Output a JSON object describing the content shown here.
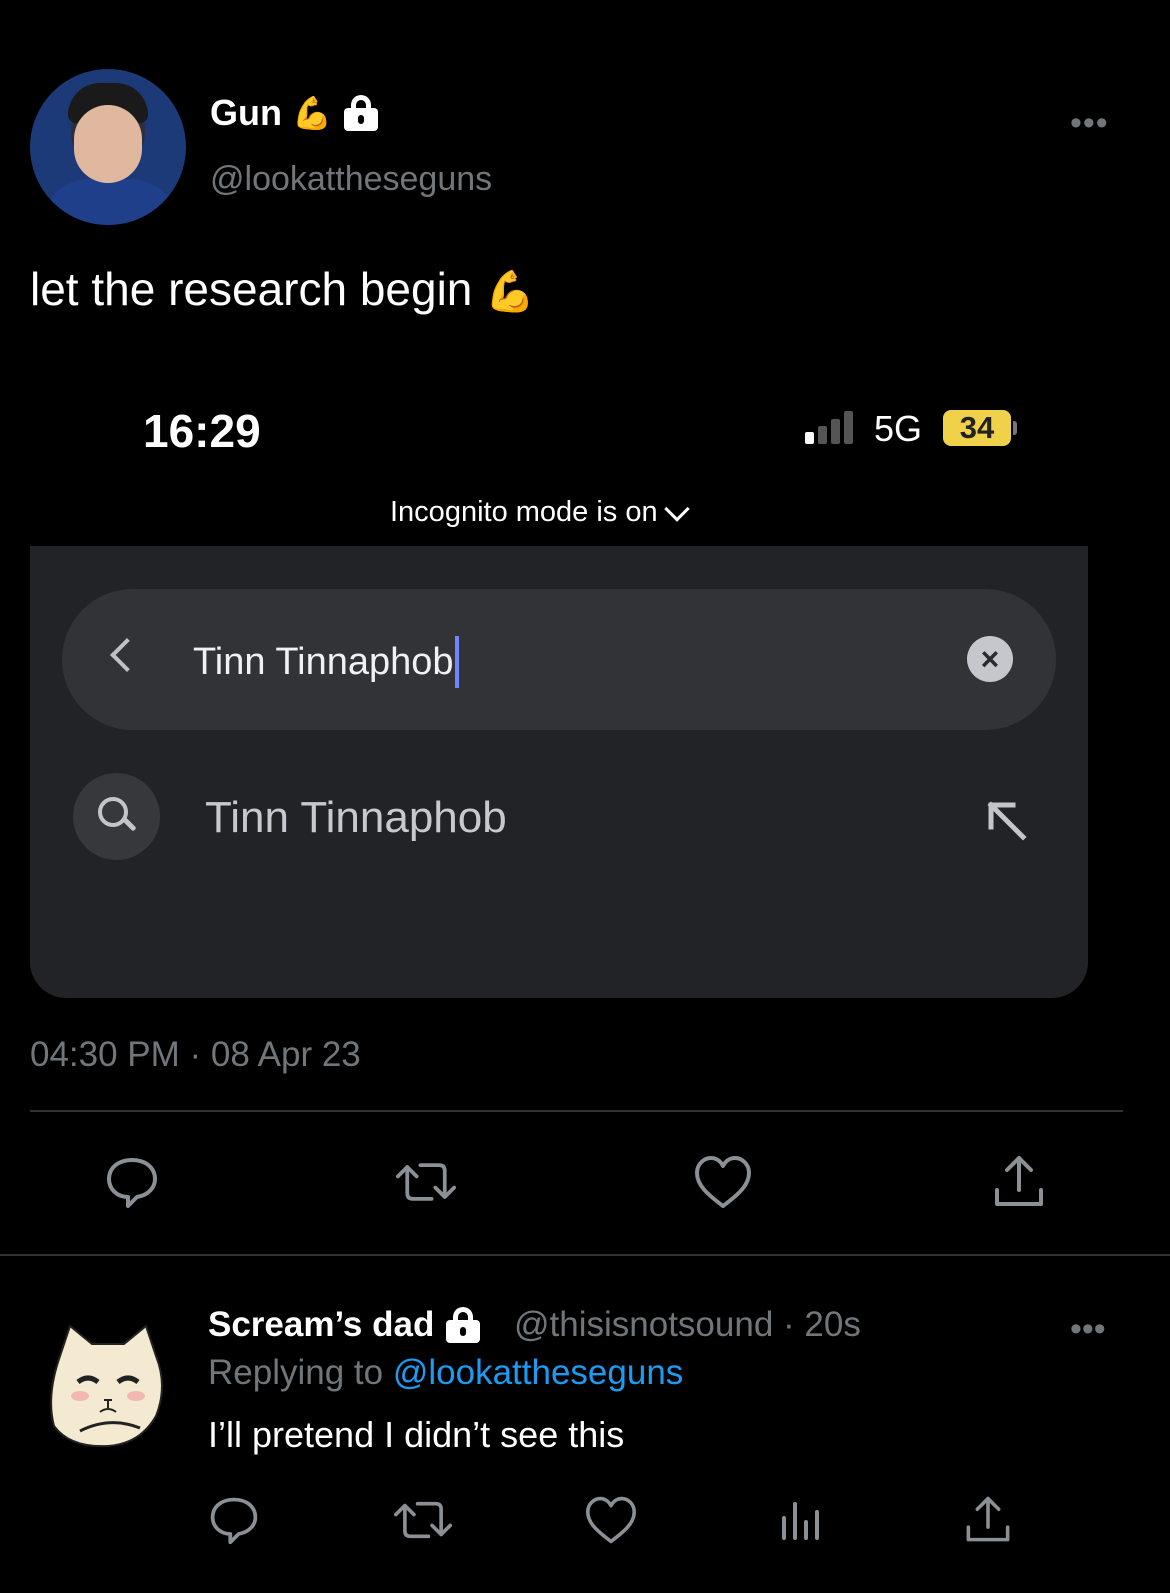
{
  "tweet": {
    "display_name": "Gun",
    "name_emoji": "💪",
    "handle": "@lookattheseguns",
    "more_label": "•••",
    "text": "let the research begin",
    "text_emoji": "💪",
    "timestamp": "04:30 PM · 08 Apr 23"
  },
  "embedded_screenshot": {
    "status_time": "16:29",
    "network": "5G",
    "battery": "34",
    "incognito_label": "Incognito mode is on",
    "search_value": "Tinn Tinnaphob",
    "clear_label": "×",
    "suggestion": "Tinn Tinnaphob"
  },
  "actions": [
    {
      "icon": "reply-icon"
    },
    {
      "icon": "retweet-icon"
    },
    {
      "icon": "like-icon"
    },
    {
      "icon": "share-icon"
    }
  ],
  "reply": {
    "display_name": "Scream’s dad",
    "handle_time": "@thisisnotsound · 20s",
    "more_label": "•••",
    "replying_prefix": "Replying to",
    "replying_handle": "@lookattheseguns",
    "text": "I’ll pretend I didn’t see this"
  },
  "colors": {
    "background": "#000000",
    "secondary_text": "#71767b",
    "accent": "#1d9bf0"
  }
}
